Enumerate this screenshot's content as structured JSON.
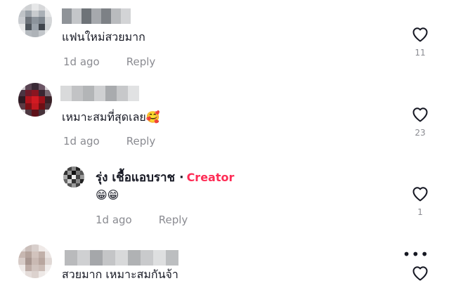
{
  "comments": [
    {
      "text": "แฟนใหม่สวยมาก",
      "time": "1d ago",
      "reply_label": "Reply",
      "likes": "11"
    },
    {
      "text": "เหมาะสมที่สุดเลย🥰",
      "time": "1d ago",
      "reply_label": "Reply",
      "likes": "23"
    },
    {
      "creator_name": "รุ่ง เชื้อแอบราช",
      "separator": "·",
      "creator_badge": "Creator",
      "text": "😁😁",
      "time": "1d ago",
      "reply_label": "Reply",
      "likes": "1"
    },
    {
      "text": "สวยมาก เหมาะสมกันจ้า",
      "more_label": "•••"
    }
  ],
  "colors": {
    "creator_accent": "#fe2c55",
    "meta_gray": "#8a8b91",
    "text_dark": "#161823"
  },
  "icons": {
    "like": "heart-outline-icon",
    "more": "more-horizontal-icon"
  }
}
